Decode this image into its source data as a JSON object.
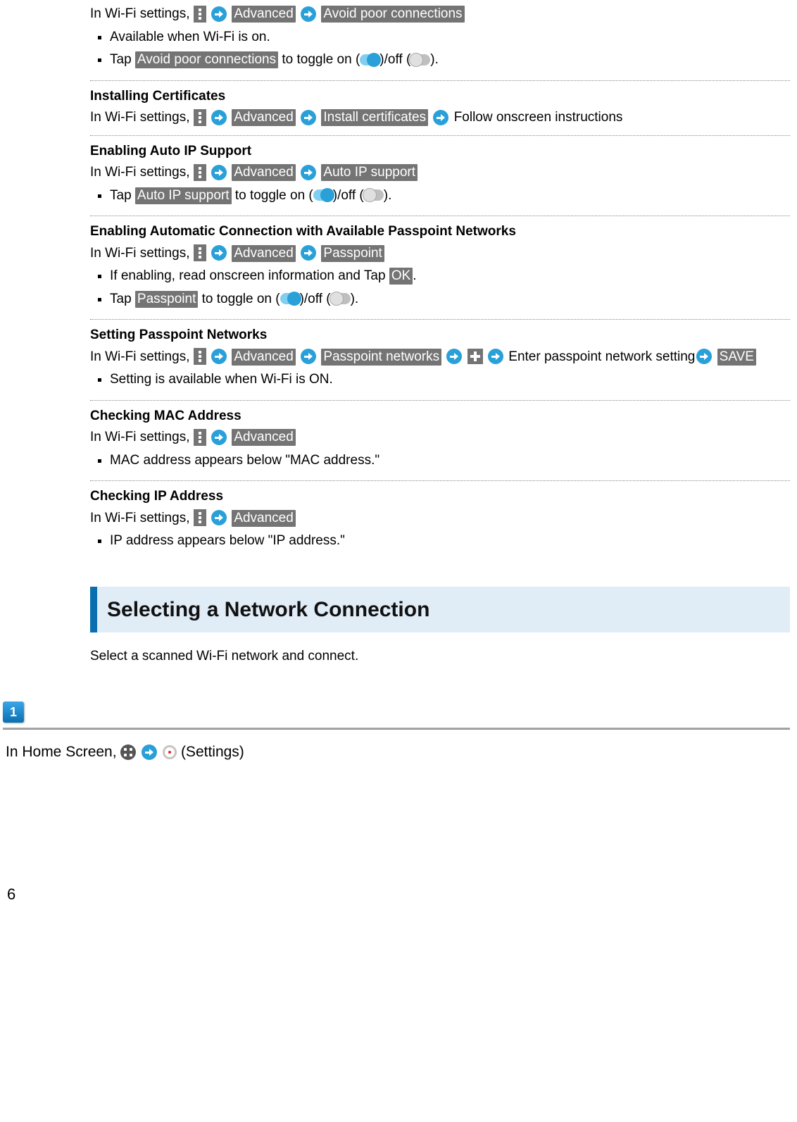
{
  "common": {
    "in_wifi": "In Wi-Fi settings, ",
    "advanced": "Advanced",
    "tap": "Tap ",
    "toggle_prefix": " to toggle on (",
    "toggle_mid": ")/off (",
    "toggle_suffix": ")."
  },
  "sec0": {
    "chip": "Avoid poor connections",
    "b1": "Available when Wi-Fi is on.",
    "b2_chip": "Avoid poor connections"
  },
  "sec1": {
    "title": "Installing Certificates",
    "chip": "Install certificates",
    "after": " Follow onscreen instructions"
  },
  "sec2": {
    "title": "Enabling Auto IP Support",
    "chip": "Auto IP support",
    "b1_chip": "Auto IP support"
  },
  "sec3": {
    "title": "Enabling Automatic Connection with Available Passpoint Networks",
    "chip": "Passpoint",
    "b1_pre": "If enabling, read onscreen information and Tap ",
    "b1_chip": "OK",
    "b1_post": ".",
    "b2_chip": "Passpoint"
  },
  "sec4": {
    "title": "Setting Passpoint Networks",
    "chip1": "Passpoint networks",
    "mid": " Enter passpoint network setting",
    "chip2": "SAVE",
    "b1": "Setting is available when Wi-Fi is ON."
  },
  "sec5": {
    "title": "Checking MAC Address",
    "b1": "MAC address appears below \"MAC address.\""
  },
  "sec6": {
    "title": "Checking IP Address",
    "b1": "IP address appears below \"IP address.\""
  },
  "heading": "Selecting a Network Connection",
  "intro": "Select a scanned Wi-Fi network and connect.",
  "step1": {
    "num": "1",
    "pre": "In Home Screen, ",
    "post": " (Settings)"
  },
  "page": "6"
}
